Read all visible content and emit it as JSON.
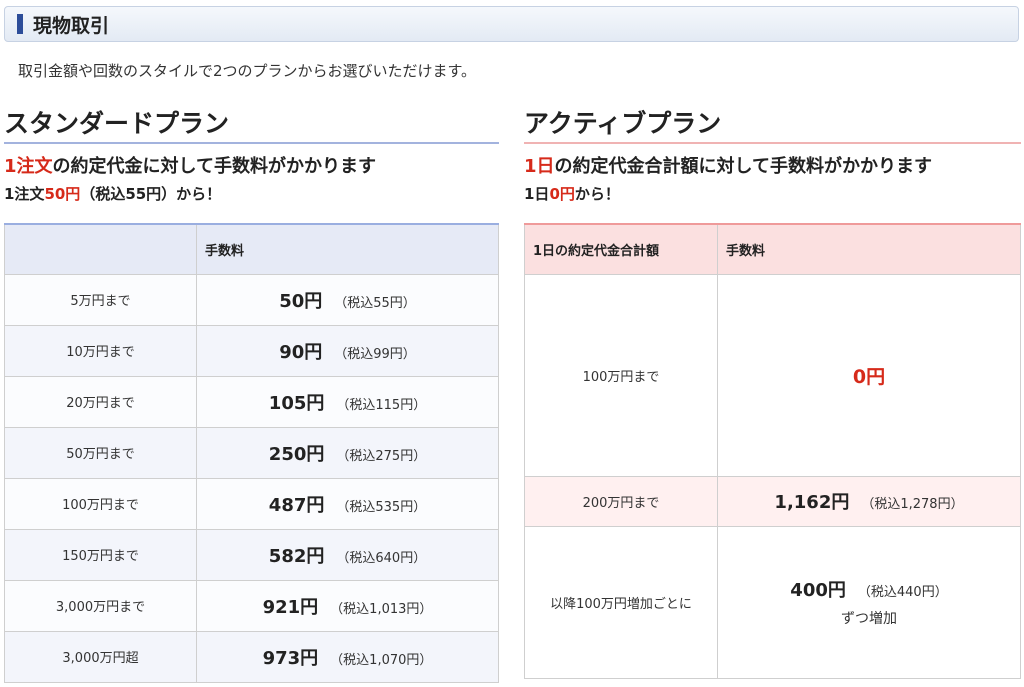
{
  "header": {
    "title": "現物取引"
  },
  "intro": "取引金額や回数のスタイルで2つのプランからお選びいただけます。",
  "standard": {
    "title": "スタンダードプラン",
    "lead_red": "1注文",
    "lead_rest": "の約定代金に対して手数料がかかります",
    "sub_pre": "1注文",
    "sub_red": "50円",
    "sub_post": "（税込55円）から！",
    "table_header": {
      "col1": "",
      "col2": "手数料"
    },
    "rows": [
      {
        "range": "5万円まで",
        "fee": "50円",
        "tax": "（税込55円）"
      },
      {
        "range": "10万円まで",
        "fee": "90円",
        "tax": "（税込99円）"
      },
      {
        "range": "20万円まで",
        "fee": "105円",
        "tax": "（税込115円）"
      },
      {
        "range": "50万円まで",
        "fee": "250円",
        "tax": "（税込275円）"
      },
      {
        "range": "100万円まで",
        "fee": "487円",
        "tax": "（税込535円）"
      },
      {
        "range": "150万円まで",
        "fee": "582円",
        "tax": "（税込640円）"
      },
      {
        "range": "3,000万円まで",
        "fee": "921円",
        "tax": "（税込1,013円）"
      },
      {
        "range": "3,000万円超",
        "fee": "973円",
        "tax": "（税込1,070円）"
      }
    ]
  },
  "active": {
    "title": "アクティブプラン",
    "lead_red": "1日",
    "lead_rest": "の約定代金合計額に対して手数料がかかります",
    "sub_pre": "1日",
    "sub_red": "0円",
    "sub_post": "から！",
    "table_header": {
      "col1": "1日の約定代金合計額",
      "col2": "手数料"
    },
    "rows": [
      {
        "range": "100万円まで",
        "fee": "0円",
        "tax": "",
        "note": ""
      },
      {
        "range": "200万円まで",
        "fee": "1,162円",
        "tax": "（税込1,278円）",
        "note": ""
      },
      {
        "range": "以降100万円増加ごとに",
        "fee": "400円",
        "tax": "（税込440円）",
        "note": "ずつ増加"
      }
    ]
  },
  "colors": {
    "accent_red": "#d62a1a",
    "standard_accent": "#9aaee0",
    "active_accent": "#ef9a9a"
  }
}
